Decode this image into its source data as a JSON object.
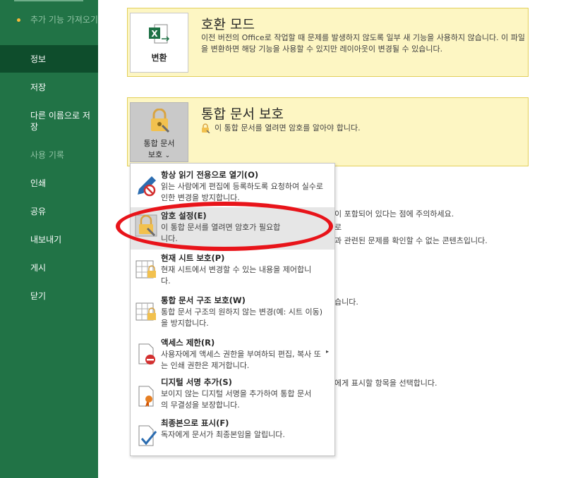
{
  "sidebar": {
    "items": [
      {
        "label": "추가 기능 가져오기",
        "state": "dim"
      },
      {
        "label": "정보",
        "state": "active"
      },
      {
        "label": "저장",
        "state": "normal"
      },
      {
        "label": "다른 이름으로 저장",
        "state": "normal"
      },
      {
        "label": "사용 기록",
        "state": "dim"
      },
      {
        "label": "인쇄",
        "state": "normal"
      },
      {
        "label": "공유",
        "state": "normal"
      },
      {
        "label": "내보내기",
        "state": "normal"
      },
      {
        "label": "게시",
        "state": "normal"
      },
      {
        "label": "닫기",
        "state": "normal"
      }
    ]
  },
  "compat": {
    "button_label": "변환",
    "title": "호환 모드",
    "desc": "이전 버전의 Office로 작업할 때 문제를 발생하지 않도록 일부 새 기능을 사용하지 않습니다. 이 파일을 변환하면 해당 기능을 사용할 수 있지만 레이아웃이 변경될 수 있습니다."
  },
  "protect": {
    "button_label_line1": "통합 문서",
    "button_label_line2": "보호",
    "button_arrow": "⌄",
    "title": "통합 문서 보호",
    "desc": "이 통합 문서를 열려면 암호를 알아야 합니다."
  },
  "background_texts": [
    "이 포함되어 있다는 점에 주의하세요.",
    "로",
    "과 관련된 문제를 확인할 수 없는 콘텐츠입니다.",
    "습니다.",
    "에게 표시할 항목을 선택합니다."
  ],
  "menu": {
    "items": [
      {
        "title": "항상 읽기 전용으로 열기(O)",
        "desc": "읽는 사람에게 편집에 등록하도록 요청하여 실수로 인한 변경을 방지합니다.",
        "icon": "pencil-no-icon"
      },
      {
        "title": "암호 설정(E)",
        "desc": "이 통합 문서를 열려면 암호가 필요합니다.",
        "icon": "lock-key-icon"
      },
      {
        "title": "현재 시트 보호(P)",
        "desc": "현재 시트에서 변경할 수 있는 내용을 제어합니다.",
        "icon": "sheet-lock-icon"
      },
      {
        "title": "통합 문서 구조 보호(W)",
        "desc": "통합 문서 구조의 원하지 않는 변경(예: 시트 이동)을 방지합니다.",
        "icon": "workbook-lock-icon"
      },
      {
        "title": "액세스 제한(R)",
        "desc": "사용자에게 액세스 권한을 부여하되 편집, 복사 또는 인쇄 권한은 제거합니다.",
        "icon": "doc-restrict-icon",
        "submenu": "▸"
      },
      {
        "title": "디지털 서명 추가(S)",
        "desc": "보이지 않는 디지털 서명을 추가하여 통합 문서의 무결성을 보장합니다.",
        "icon": "doc-ribbon-icon"
      },
      {
        "title": "최종본으로 표시(F)",
        "desc": "독자에게 문서가 최종본임을 알립니다.",
        "icon": "doc-check-icon"
      }
    ]
  },
  "colors": {
    "sidebar": "#217346",
    "sidebar_active": "#0e4d2c",
    "card_bg": "#fdf6c3",
    "card_border": "#e2cf5a",
    "highlight": "#e8141a"
  }
}
